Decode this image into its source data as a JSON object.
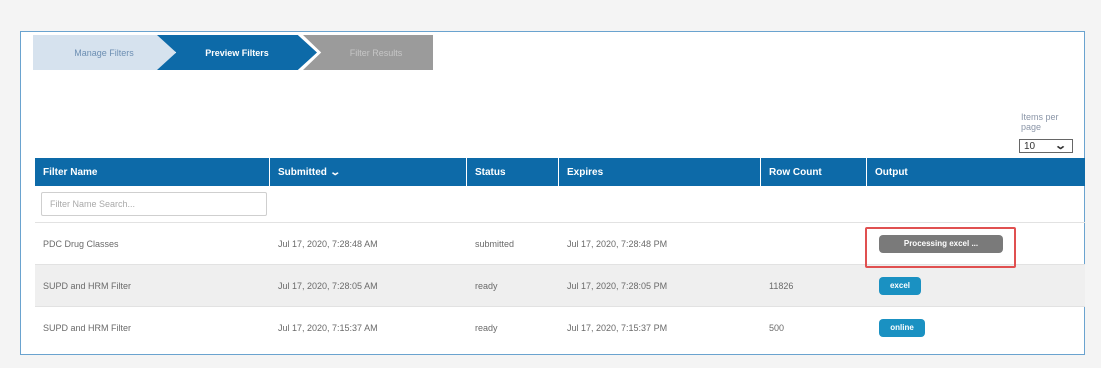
{
  "wizard": {
    "steps": [
      "Manage Filters",
      "Preview Filters",
      "Filter Results"
    ]
  },
  "pagination": {
    "items_per_page_label": "Items per page",
    "items_per_page_value": "10"
  },
  "table": {
    "headers": [
      "Filter Name",
      "Submitted",
      "Status",
      "Expires",
      "Row Count",
      "Output"
    ],
    "search_placeholder": "Filter Name Search...",
    "rows": [
      {
        "name": "PDC Drug Classes",
        "submitted": "Jul 17, 2020, 7:28:48 AM",
        "status": "submitted",
        "expires": "Jul 17, 2020, 7:28:48 PM",
        "row_count": "",
        "output": "Processing excel ..."
      },
      {
        "name": "SUPD and HRM Filter",
        "submitted": "Jul 17, 2020, 7:28:05 AM",
        "status": "ready",
        "expires": "Jul 17, 2020, 7:28:05 PM",
        "row_count": "11826",
        "output": "excel"
      },
      {
        "name": "SUPD and HRM Filter",
        "submitted": "Jul 17, 2020, 7:15:37 AM",
        "status": "ready",
        "expires": "Jul 17, 2020, 7:15:37 PM",
        "row_count": "500",
        "output": "online"
      }
    ]
  },
  "icons": {
    "sort": "chevron-down-icon",
    "select": "chevron-down-icon"
  },
  "colors": {
    "header": "#0d6aa8",
    "button_blue": "#1a91c2",
    "button_processing": "#7a7a7a",
    "highlight": "#e05050"
  }
}
